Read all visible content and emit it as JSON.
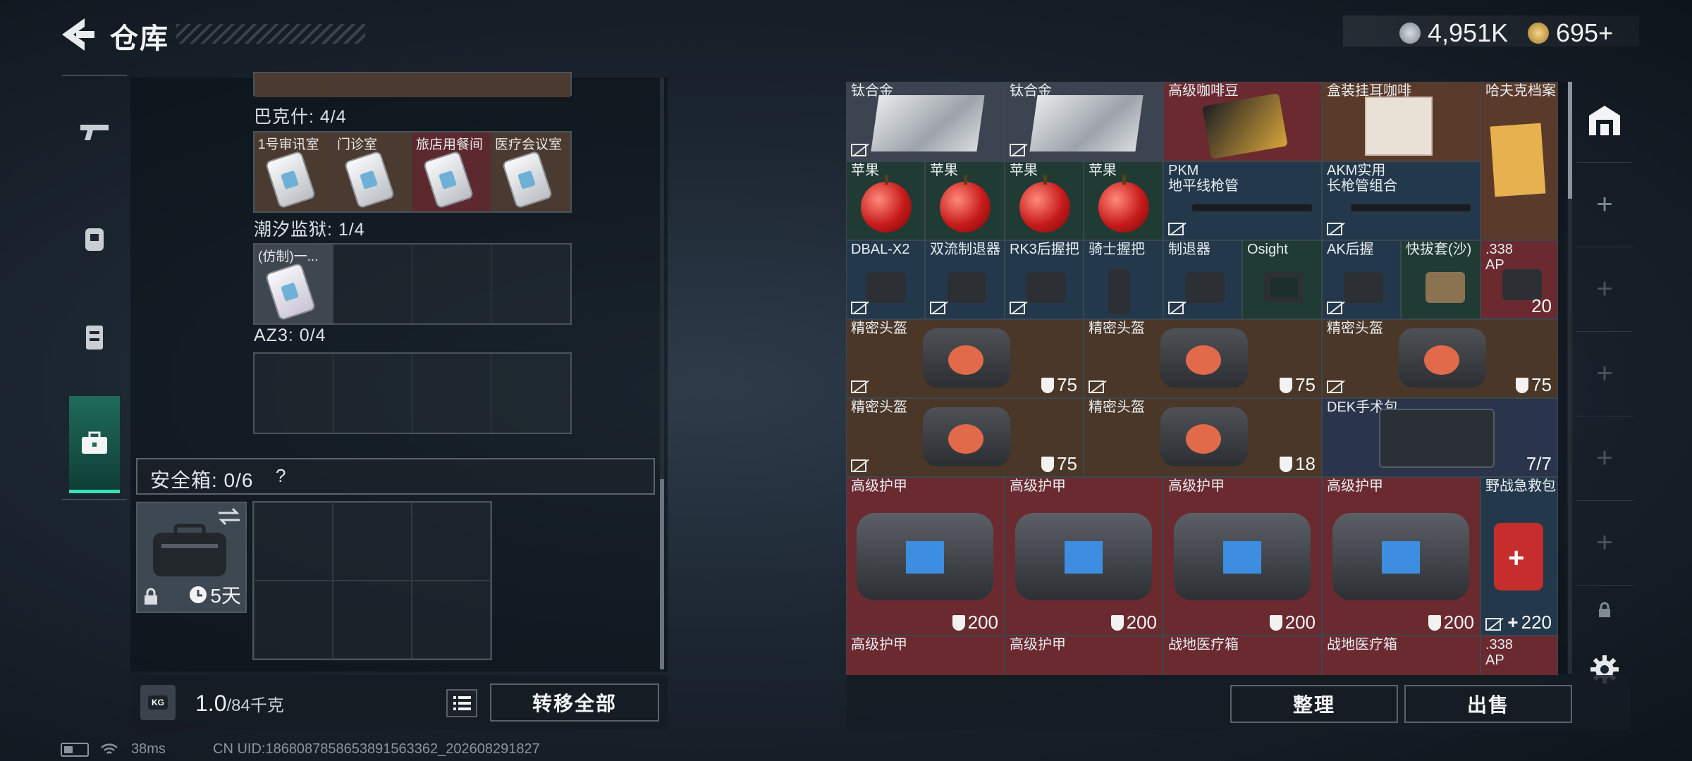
{
  "header": {
    "title": "仓库",
    "currency_silver": "4,951K",
    "currency_gold": "695+"
  },
  "left": {
    "partial_label": "巴克什: 4/4",
    "bakesh_cells": [
      "1号审讯室",
      "门诊室",
      "旅店用餐间",
      "医疗会议室"
    ],
    "prison_label": "潮汐监狱: 1/4",
    "prison_cells": [
      "(仿制)一..."
    ],
    "az3_label": "AZ3: 0/4",
    "safe_label": "安全箱: 0/6",
    "safe_help": "?",
    "safe_days": "5天",
    "weight_value": "1.0",
    "weight_max": "/84千克",
    "weight_icon": "KG",
    "transfer_label": "转移全部"
  },
  "status": {
    "ping": "38ms",
    "uid": "CN UID:1868087858653891563362_202608291827"
  },
  "stash": {
    "row1": [
      "钛合金",
      "钛合金",
      "高级咖啡豆",
      "盒装挂耳咖啡",
      "哈夫克档案"
    ],
    "row2": [
      "苹果",
      "苹果",
      "苹果",
      "苹果",
      "PKM\n地平线枪管",
      "AKM实用\n长枪管组合"
    ],
    "row3": [
      "DBAL-X2",
      "双流制退器",
      "RK3后握把",
      "骑士握把",
      "制退器",
      "Osight",
      "AK后握",
      "快拔套(沙)",
      ".338\nAP"
    ],
    "ammo_count": "20",
    "helmet_label": "精密头盔",
    "helmet_vals": [
      "75",
      "75",
      "75",
      "75",
      "18"
    ],
    "dek_label": "DEK手术包",
    "dek_count": "7/7",
    "armor_label": "高级护甲",
    "armor_vals": [
      "200",
      "200",
      "200",
      "200"
    ],
    "field_kit_label": "野战急救包",
    "field_kit_val": "220",
    "row8": [
      "高级护甲",
      "高级护甲",
      "战地医疗箱",
      "战地医疗箱",
      ".338\nAP"
    ]
  },
  "buttons": {
    "sort": "整理",
    "sell": "出售"
  },
  "colors": {
    "accent": "#39e0b3",
    "rarity_red": "#6a2a30",
    "rarity_blue": "#23394b",
    "rarity_brown": "#4a3728"
  }
}
